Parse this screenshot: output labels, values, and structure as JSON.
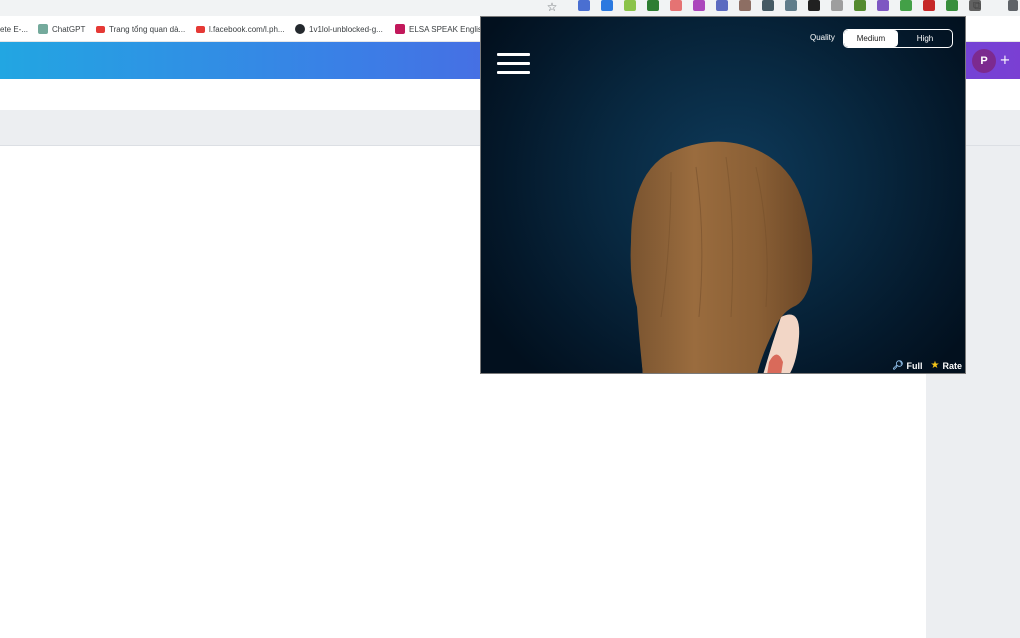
{
  "browser": {
    "star_icon": "star-icon",
    "extensions": [
      {
        "icon": "mail-icon",
        "color": "#4a6fd1"
      },
      {
        "icon": "translate-icon",
        "color": "#2b79e0"
      },
      {
        "icon": "leaf-icon",
        "color": "#8bc34a"
      },
      {
        "icon": "shield-icon",
        "color": "#2e7d32"
      },
      {
        "icon": "photo-icon",
        "color": "#e57373"
      },
      {
        "icon": "palette-icon",
        "color": "#ab47bc"
      },
      {
        "icon": "grid-icon",
        "color": "#5c6bc0"
      },
      {
        "icon": "game-icon",
        "color": "#8d6e63"
      },
      {
        "icon": "film-icon",
        "color": "#455a64"
      },
      {
        "icon": "window-icon",
        "color": "#607d8b"
      },
      {
        "icon": "dark-icon",
        "color": "#212121"
      },
      {
        "icon": "settings-icon",
        "color": "#9e9e9e"
      },
      {
        "icon": "puzzle-game-icon",
        "color": "#558b2f"
      },
      {
        "icon": "purple-icon",
        "color": "#7e57c2"
      },
      {
        "icon": "cube-icon",
        "color": "#43a047"
      },
      {
        "icon": "home-icon",
        "color": "#c62828"
      },
      {
        "icon": "kaomoji-icon",
        "color": "#388e3c"
      },
      {
        "icon": "avatar-ext-icon",
        "color": "#616161"
      }
    ]
  },
  "bookmarks": [
    {
      "label": "ete E-...",
      "icon": "page-icon",
      "color": "#9e9e9e"
    },
    {
      "label": "ChatGPT",
      "icon": "chatgpt-icon",
      "color": "#74aa9c"
    },
    {
      "label": "Trang tổng quan dà...",
      "icon": "link-icon",
      "color": "#e53935"
    },
    {
      "label": "l.facebook.com/l.ph...",
      "icon": "link-icon",
      "color": "#e53935"
    },
    {
      "label": "1v1lol-unblocked-g...",
      "icon": "github-icon",
      "color": "#24292e"
    },
    {
      "label": "ELSA SPEAK English...",
      "icon": "elsa-icon",
      "color": "#c2185b"
    }
  ],
  "page": {
    "avatar_letter": "P",
    "plus": "+"
  },
  "popup": {
    "quality_label": "Quality",
    "quality_options": [
      "Medium",
      "High"
    ],
    "quality_selected": "Medium",
    "full_label": "Full",
    "rate_label": "Rate"
  }
}
